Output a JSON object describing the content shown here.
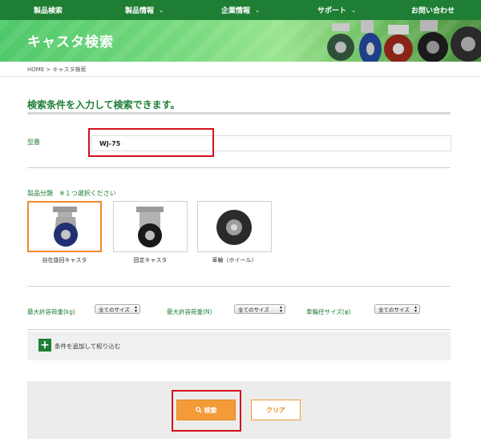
{
  "nav": {
    "items": [
      {
        "label": "製品検索",
        "chevron": false
      },
      {
        "label": "製品情報",
        "chevron": true
      },
      {
        "label": "企業情報",
        "chevron": true
      },
      {
        "label": "サポート",
        "chevron": true
      },
      {
        "label": "お問い合わせ",
        "chevron": false
      }
    ],
    "chevron_glyph": "⌄"
  },
  "banner": {
    "title": "キャスタ検索"
  },
  "breadcrumb": "HOME > キャスタ検索",
  "search_form": {
    "heading": "検索条件を入力して検索できます。",
    "model": {
      "label": "型番",
      "value": "WJ-75"
    },
    "category": {
      "label": "製品分類　※１つ選択ください",
      "options": [
        {
          "caption": "自在旋回キャスタ",
          "selected": true,
          "icon": "swivel-caster-image"
        },
        {
          "caption": "固定キャスタ",
          "selected": false,
          "icon": "fixed-caster-image"
        },
        {
          "caption": "車輪（ホイール）",
          "selected": false,
          "icon": "wheel-image"
        }
      ]
    },
    "filters": [
      {
        "label": "最大許容荷重(kg)",
        "value": "全てのサイズ"
      },
      {
        "label": "最大許容荷重(N)",
        "value": "全てのサイズ"
      },
      {
        "label": "車輪径サイズ(φ)",
        "value": "全てのサイズ"
      }
    ],
    "add_condition": {
      "icon": "plus-icon",
      "label": "条件を追加して絞り込む"
    },
    "search_button": {
      "label": "検索",
      "icon": "search-icon"
    },
    "clear_button": {
      "label": "クリア"
    }
  },
  "colors": {
    "brand_green": "#1e7e34",
    "accent_orange": "#f29b38",
    "highlight_red": "#d4101b"
  }
}
